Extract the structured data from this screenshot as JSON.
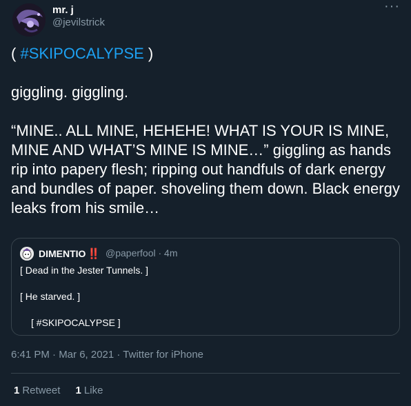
{
  "author": {
    "display_name": "mr. j",
    "handle": "@jevilstrick",
    "avatar_icon": "purple-jester-avatar"
  },
  "more_icon": "···",
  "tweet": {
    "line1_open": "( ",
    "line1_hashtag": "#SKIPOCALYPSE",
    "line1_close": " )",
    "para2": "giggling.  giggling.",
    "para3": "“MINE.. ALL MINE, HEHEHE! WHAT IS YOUR IS MINE, MINE AND WHAT’S MINE IS MINE…” giggling as hands rip into papery flesh; ripping out handfuls of dark energy and bundles of paper. shoveling them down. Black energy leaks from his smile…"
  },
  "quote": {
    "name": "DIMENTIO",
    "emoji": "‼️",
    "handle_time": "@paperfool · 4m",
    "line1": "[ Dead in the Jester Tunnels. ]",
    "line2": "[ He starved. ]",
    "line3": "[ #SKIPOCALYPSE ]",
    "avatar_icon": "dimentio-avatar"
  },
  "meta": "6:41 PM · Mar 6, 2021 · Twitter for iPhone",
  "stats": {
    "retweets_count": "1",
    "retweets_label": "Retweet",
    "likes_count": "1",
    "likes_label": "Like"
  },
  "colors": {
    "background": "#15202b",
    "link": "#1da1f2",
    "secondary_text": "#8899a6",
    "border": "#38444d",
    "emoji_red": "#e0245e"
  }
}
